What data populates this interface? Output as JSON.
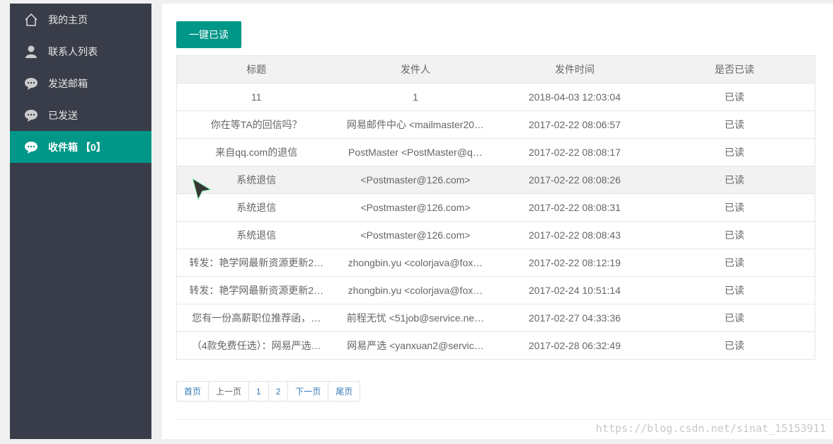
{
  "sidebar": {
    "items": [
      {
        "label": "我的主页",
        "icon": "home-icon"
      },
      {
        "label": "联系人列表",
        "icon": "user-icon"
      },
      {
        "label": "发送邮箱",
        "icon": "chat-icon"
      },
      {
        "label": "已发送",
        "icon": "chat-icon"
      },
      {
        "label": "收件箱 【0】",
        "icon": "chat-icon",
        "active": true
      }
    ]
  },
  "toolbar": {
    "mark_all_read_label": "一键已读"
  },
  "table": {
    "headers": [
      "标题",
      "发件人",
      "发件时间",
      "是否已读"
    ],
    "rows": [
      [
        "11",
        "1",
        "2018-04-03 12:03:04",
        "已读"
      ],
      [
        "你在等TA的回信吗？",
        "网易邮件中心 <mailmaster20…",
        "2017-02-22 08:06:57",
        "已读"
      ],
      [
        "来自qq.com的退信",
        "PostMaster <PostMaster@q…",
        "2017-02-22 08:08:17",
        "已读"
      ],
      [
        "系统退信",
        "<Postmaster@126.com>",
        "2017-02-22 08:08:26",
        "已读"
      ],
      [
        "系统退信",
        "<Postmaster@126.com>",
        "2017-02-22 08:08:31",
        "已读"
      ],
      [
        "系统退信",
        "<Postmaster@126.com>",
        "2017-02-22 08:08:43",
        "已读"
      ],
      [
        "转发：艳学网最新资源更新2…",
        "zhongbin.yu <colorjava@fox…",
        "2017-02-22 08:12:19",
        "已读"
      ],
      [
        "转发：艳学网最新资源更新2…",
        "zhongbin.yu <colorjava@fox…",
        "2017-02-24 10:51:14",
        "已读"
      ],
      [
        "您有一份高薪职位推荐函，…",
        "前程无忧 <51job@service.ne…",
        "2017-02-27 04:33:36",
        "已读"
      ],
      [
        "（4款免费任选）：网易严选…",
        "网易严选 <yanxuan2@servic…",
        "2017-02-28 06:32:49",
        "已读"
      ]
    ]
  },
  "pager": {
    "first": "首页",
    "prev": "上一页",
    "pages": [
      "1",
      "2"
    ],
    "next": "下一页",
    "last": "尾页"
  },
  "watermark": "https://blog.csdn.net/sinat_15153911",
  "colors": {
    "accent": "#009688",
    "sidebar_bg": "#393d49"
  }
}
